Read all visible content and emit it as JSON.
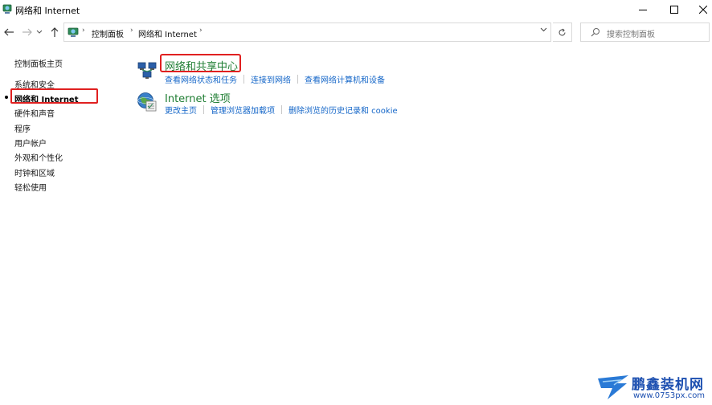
{
  "window": {
    "title": "网络和 Internet"
  },
  "address_bar": {
    "crumbs": [
      "控制面板",
      "网络和 Internet"
    ],
    "search_placeholder": "搜索控制面板"
  },
  "sidebar": {
    "home": "控制面板主页",
    "items": [
      "系统和安全",
      "网络和 Internet",
      "硬件和声音",
      "程序",
      "用户帐户",
      "外观和个性化",
      "时钟和区域",
      "轻松使用"
    ],
    "current_index": 1
  },
  "categories": [
    {
      "title": "网络和共享中心",
      "icon": "network-sharing-center-icon",
      "links": [
        "查看网络状态和任务",
        "连接到网络",
        "查看网络计算机和设备"
      ]
    },
    {
      "title": "Internet 选项",
      "icon": "internet-options-icon",
      "links": [
        "更改主页",
        "管理浏览器加载项",
        "删除浏览的历史记录和 cookie"
      ]
    }
  ],
  "watermark": {
    "name": "鹏鑫装机网",
    "url": "www.0753px.com"
  },
  "colors": {
    "link": "#1466c8",
    "category_title": "#1e7d32",
    "highlight": "#e02020"
  }
}
